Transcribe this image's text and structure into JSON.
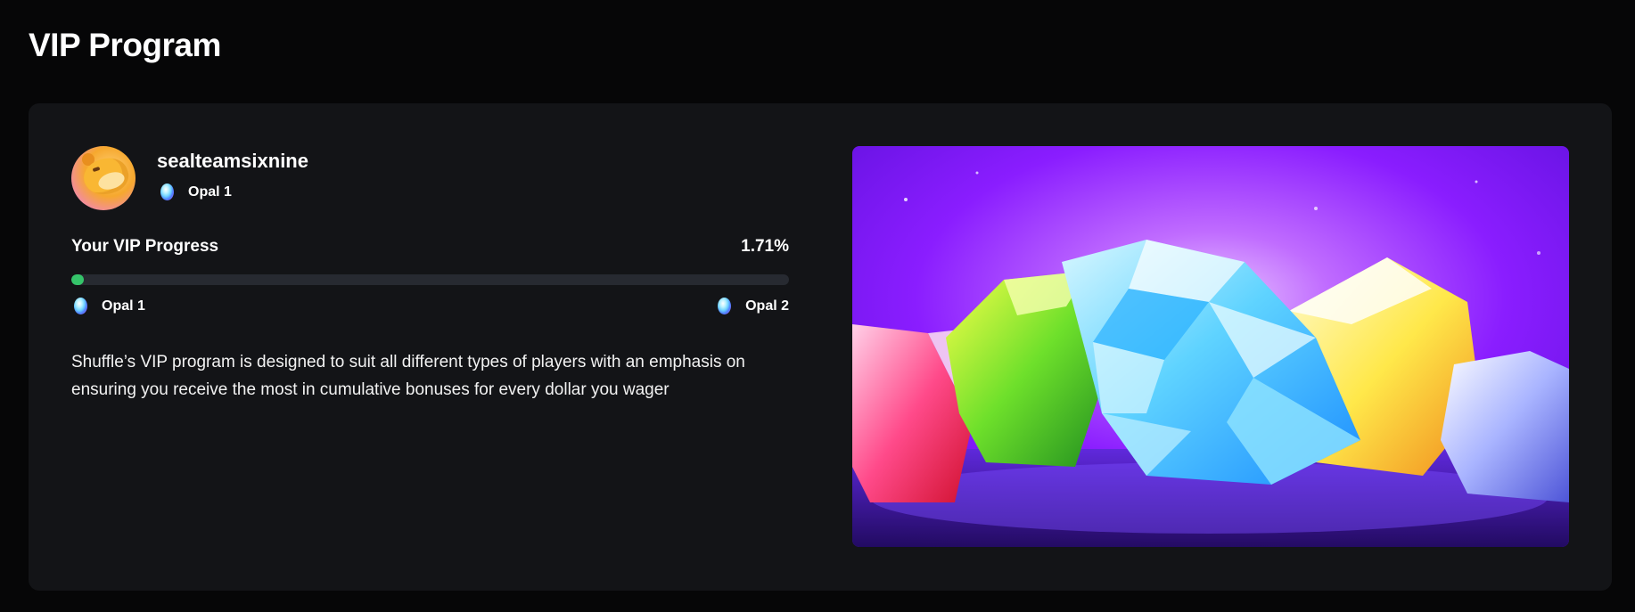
{
  "page": {
    "title": "VIP Program"
  },
  "profile": {
    "username": "sealteamsixnine",
    "rank": "Opal 1",
    "rank_icon": "opal-gem-icon",
    "avatar_icon": "bear-avatar-icon"
  },
  "progress": {
    "label": "Your VIP Progress",
    "percent_text": "1.71%",
    "value_percent": 1.71,
    "current_level": "Opal 1",
    "next_level": "Opal 2",
    "fill_color": "#35c46a",
    "track_color": "#272a31"
  },
  "description": "Shuffle’s VIP program is designed to suit all different types of players with an emphasis on ensuring you receive the most in cumulative bonuses for every dollar you wager",
  "colors": {
    "background": "#060607",
    "card": "#131417",
    "accent_purple": "#8a2cff"
  }
}
